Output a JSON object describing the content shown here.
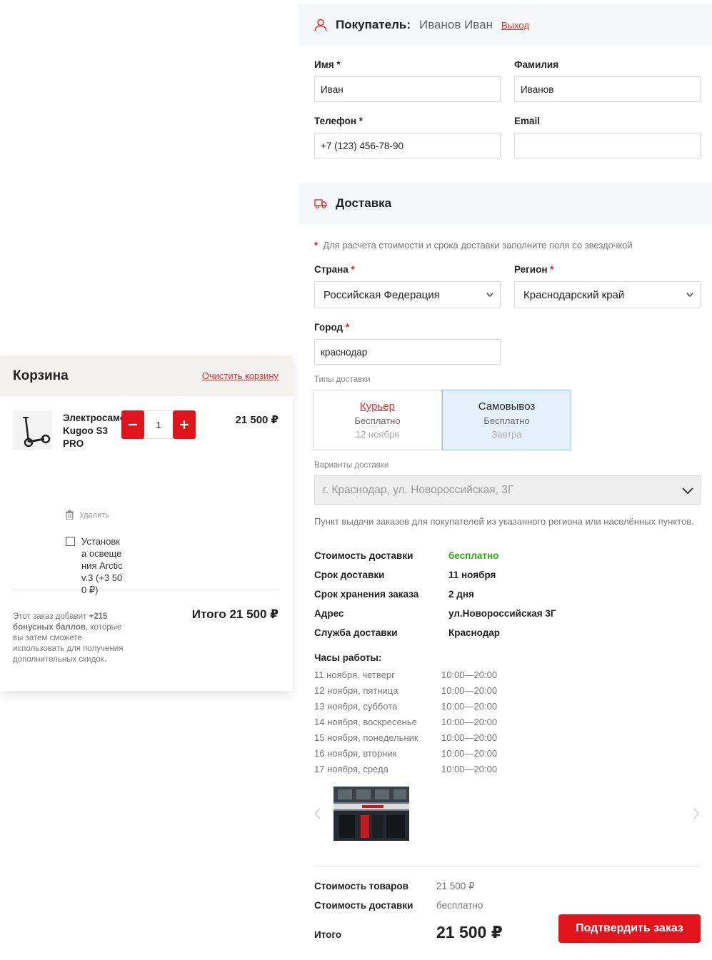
{
  "cart": {
    "title": "Корзина",
    "clear_label": "Очистить корзину",
    "item": {
      "name": "Электросамокат Kugoo S3 PRO",
      "quantity": "1",
      "price": "21 500 ₽",
      "delete_label": "Удалить",
      "option_label": "Установка освещения Arctic v.3 (+3 500 ₽)",
      "option_checked": false
    },
    "bonus_prefix": "Этот заказ добавит ",
    "bonus_strong": "+215 бонусных баллов",
    "bonus_suffix": ", которые вы затем сможете использовать для получения дополнительных скидок.",
    "total": "Итого 21 500 ₽"
  },
  "buyer": {
    "title": "Покупатель:",
    "name": "Иванов Иван",
    "logout_label": "Выход",
    "fields": {
      "first_name": {
        "label": "Имя",
        "value": "Иван"
      },
      "last_name": {
        "label": "Фамилия",
        "value": "Иванов"
      },
      "phone": {
        "label": "Телефон",
        "value": "+7 (123) 456-78-90"
      },
      "email": {
        "label": "Email",
        "value": ""
      }
    }
  },
  "delivery": {
    "title": "Доставка",
    "required_note": "Для расчета стоимости и срока доставки заполните поля со звездочкой",
    "country": {
      "label": "Страна",
      "value": "Российская Федерация"
    },
    "region": {
      "label": "Регион",
      "value": "Краснодарский край"
    },
    "city": {
      "label": "Город",
      "value": "краснодар"
    },
    "types_label": "Типы доставки",
    "types": [
      {
        "name": "Курьер",
        "price": "Бесплатно",
        "date": "12 ноября",
        "active": false
      },
      {
        "name": "Самовывоз",
        "price": "Бесплатно",
        "date": "Завтра",
        "active": true
      }
    ],
    "variants_label": "Варианты доставки",
    "variant_value": "г. Краснодар, ул. Новороссийская, 3Г",
    "pickup_description": "Пункт выдачи заказов для покупателей из указанного региона или населённых пунктов.",
    "info": [
      {
        "label": "Стоимость доставки",
        "value": "бесплатно",
        "highlight": true
      },
      {
        "label": "Срок доставки",
        "value": "11 ноября"
      },
      {
        "label": "Срок хранения заказа",
        "value": "2 дня"
      },
      {
        "label": "Адрес",
        "value": "ул.Новороссийская 3Г"
      },
      {
        "label": "Служба доставки",
        "value": "Краснодар"
      }
    ],
    "hours_title": "Часы работы:",
    "hours": [
      {
        "day": "11 ноября, четверг",
        "time": "10:00—20:00"
      },
      {
        "day": "12 ноября, пятница",
        "time": "10:00—20:00"
      },
      {
        "day": "13 ноября, суббота",
        "time": "10:00—20:00"
      },
      {
        "day": "14 ноября, воскресенье",
        "time": "10:00—20:00"
      },
      {
        "day": "15 ноября, понедельник",
        "time": "10:00—20:00"
      },
      {
        "day": "16 ноября, вторник",
        "time": "10:00—20:00"
      },
      {
        "day": "17 ноября, среда",
        "time": "10:00—20:00"
      }
    ]
  },
  "summary": {
    "goods_label": "Стоимость товаров",
    "goods_value": "21 500 ₽",
    "delivery_label": "Стоимость доставки",
    "delivery_value": "бесплатно",
    "total_label": "Итого",
    "total_value": "21 500 ₽",
    "confirm_label": "Подтвердить заказ"
  },
  "colors": {
    "accent": "#e2141b",
    "link": "#e2302f",
    "free_green": "#2fa90f",
    "active_tab_bg": "#e4f1fd"
  },
  "icons": {
    "buyer": "user-icon",
    "delivery": "truck-icon",
    "delete": "trash-icon",
    "select": "chevron-down-icon",
    "gallery_prev": "chevron-left-icon",
    "gallery_next": "chevron-right-icon"
  }
}
